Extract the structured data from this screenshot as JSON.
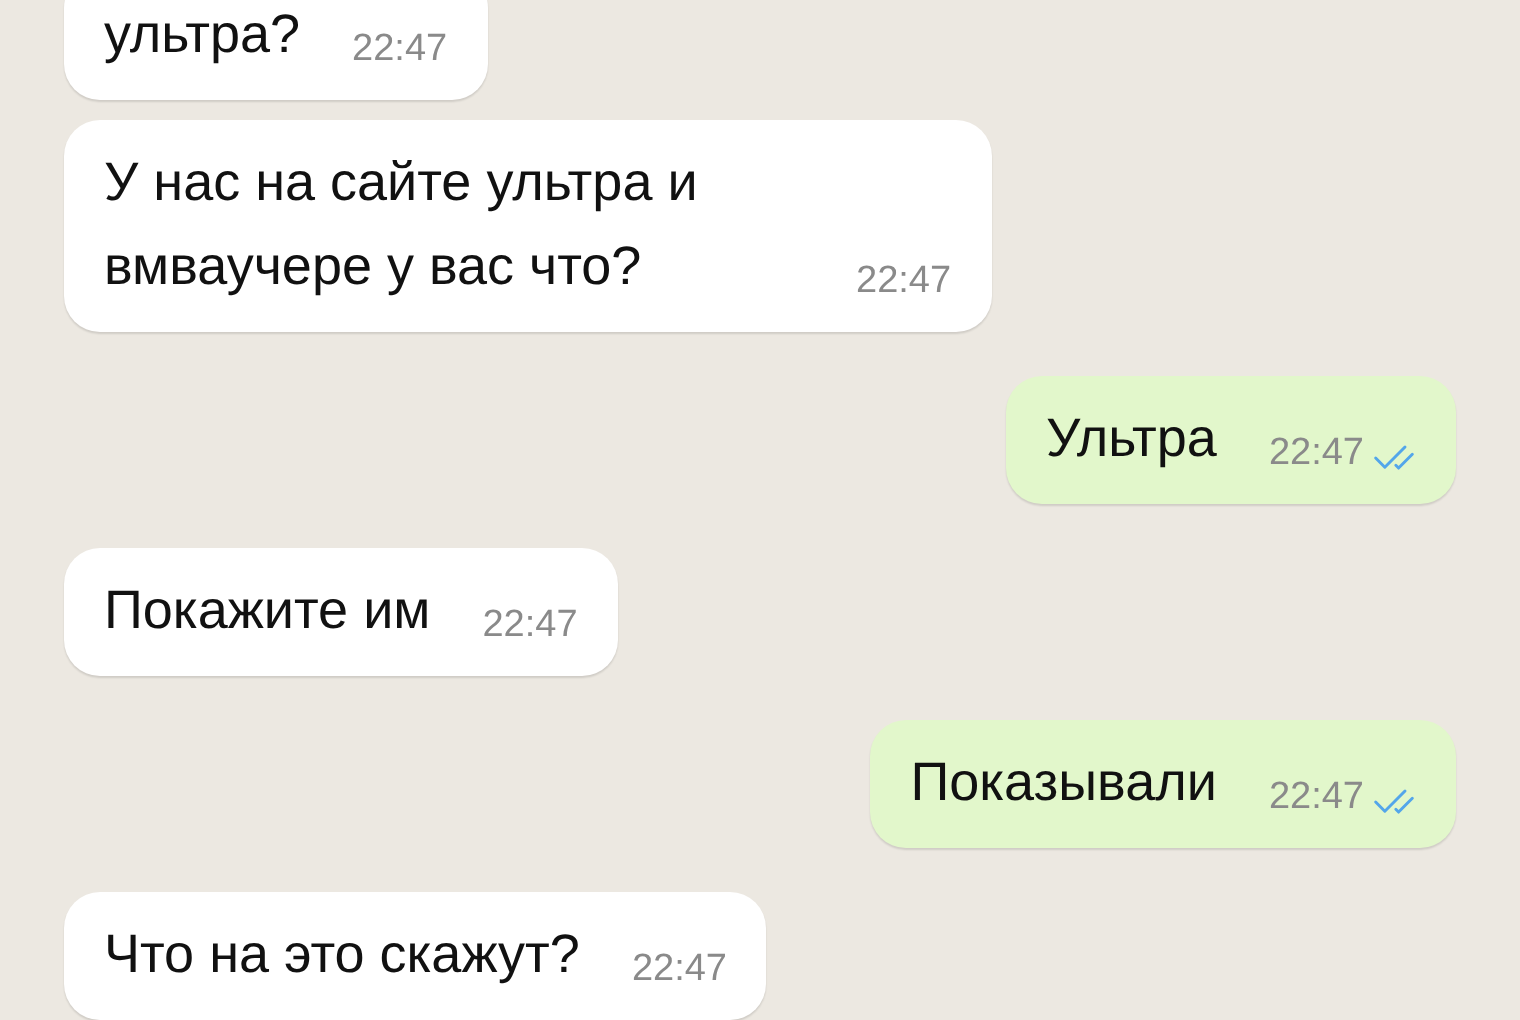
{
  "messages": [
    {
      "kind": "incoming",
      "text": "ультра?",
      "time": "22:47"
    },
    {
      "kind": "incoming",
      "text": "У нас на сайте ультра и вмваучере у вас что?",
      "time": "22:47"
    },
    {
      "kind": "outgoing",
      "text": "Ультра",
      "time": "22:47",
      "read": true
    },
    {
      "kind": "incoming",
      "text": "Покажите им",
      "time": "22:47"
    },
    {
      "kind": "outgoing",
      "text": "Показывали",
      "time": "22:47",
      "read": true
    },
    {
      "kind": "incoming",
      "text": "Что на это скажут?",
      "time": "22:47"
    }
  ]
}
